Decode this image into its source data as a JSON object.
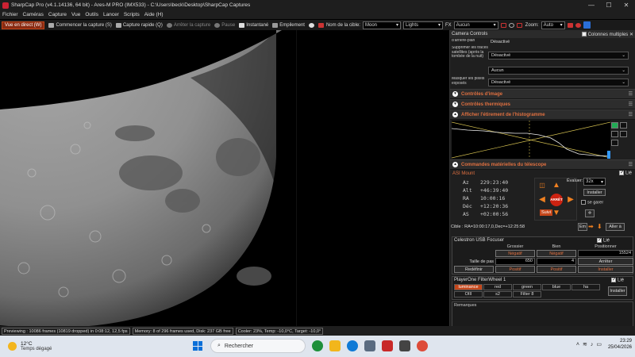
{
  "window": {
    "title": "SharpCap Pro (v4.1.14136, 64 bit) - Ares-M PRO (IMX533) - C:\\Users\\beck\\Desktop\\SharpCap Captures",
    "min": "—",
    "max": "☐",
    "close": "✕"
  },
  "menu": [
    "Fichier",
    "Caméras",
    "Capture",
    "Vue",
    "Outils",
    "Lancer",
    "Scripts",
    "Aide (H)"
  ],
  "toolbar": {
    "live": "Vue en direct (W)",
    "start_capture": "Commencer la capture (S)",
    "quick_capture": "Capture rapide (Q)",
    "stop_capture": "Arrêter la capture",
    "pause": "Pause",
    "snapshot": "Instantané",
    "stack": "Empilement",
    "target_label": "Nom de la cible:",
    "target_value": "Moon",
    "frame_type": "Lights",
    "fx_label": "FX",
    "fx_value": "Aucun",
    "zoom_label": "Zoom:",
    "zoom_value": "Auto"
  },
  "camera_controls": {
    "title": "Camera Controls",
    "multi_col_label": "Colonnes multiples",
    "rows": [
      {
        "label": "d'arrière-plan",
        "value": "Désactivé"
      },
      {
        "label": "Supprimer les traces satellites (après la tombée de la nuit)",
        "value": "Désactivé"
      },
      {
        "label": "",
        "value": "Aucun"
      },
      {
        "label": "Masquer les pixels exposés",
        "value": "Désactivé"
      }
    ]
  },
  "sections": {
    "image": "Contrôles d'image",
    "thermal": "Contrôles thermiques",
    "histogram": "Afficher l'étirement de l'histogramme",
    "telescope": "Commandes matérielles du télescope"
  },
  "mount": {
    "name": "ASI Mount",
    "lie": "Lié",
    "coords": [
      {
        "k": "Az",
        "v": "229:23:40"
      },
      {
        "k": "Alt",
        "v": "+46:39:40"
      },
      {
        "k": "RA",
        "v": "10:00:16"
      },
      {
        "k": "Déc",
        "v": "+12:20:36"
      },
      {
        "k": "AS",
        "v": "+02:00:56"
      }
    ],
    "stop": "ARRÊT",
    "suivi": "Suivi",
    "evaluer_label": "Évaluer:",
    "evaluer_value": "32x",
    "install": "Installer",
    "park": "se garer",
    "target_line": "Cible : RA=10:00:17,0,Dec=+12:25:58",
    "en_label": "Em",
    "aller": "Aller à"
  },
  "focuser": {
    "name": "Celestron USB Focuser",
    "lie": "Lié",
    "h1": "Grossier",
    "h2": "Bien",
    "h3": "Positionner",
    "neg": "Négatif",
    "pos": "Positif",
    "position": "15524",
    "step_label": "Taille de pas",
    "step_coarse": "650",
    "step_fine": "4",
    "stop": "Arrêter",
    "reset": "Redéfinir",
    "install": "Installer"
  },
  "filterwheel": {
    "name": "PlayerOne FilterWheel 1",
    "lie": "Lié",
    "filters": [
      "luminance",
      "red",
      "green",
      "blue",
      "ha",
      "OIII",
      "s2",
      "Filter 8"
    ],
    "install": "Installer"
  },
  "remarks": "Remarques",
  "status": [
    "Previewing : 10086 frames (10819 dropped) in 0:08:12, 12,5 fps",
    "Memory: 8 of 296 frames used, Disk: 237 GB free",
    "Cooler: 23%, Temp: -10,0°C, Target: -10,0°"
  ],
  "taskbar": {
    "temp": "12°C",
    "weather": "Temps dégagé",
    "search": "Rechercher",
    "time": "23:29",
    "date": "25/04/2026"
  }
}
